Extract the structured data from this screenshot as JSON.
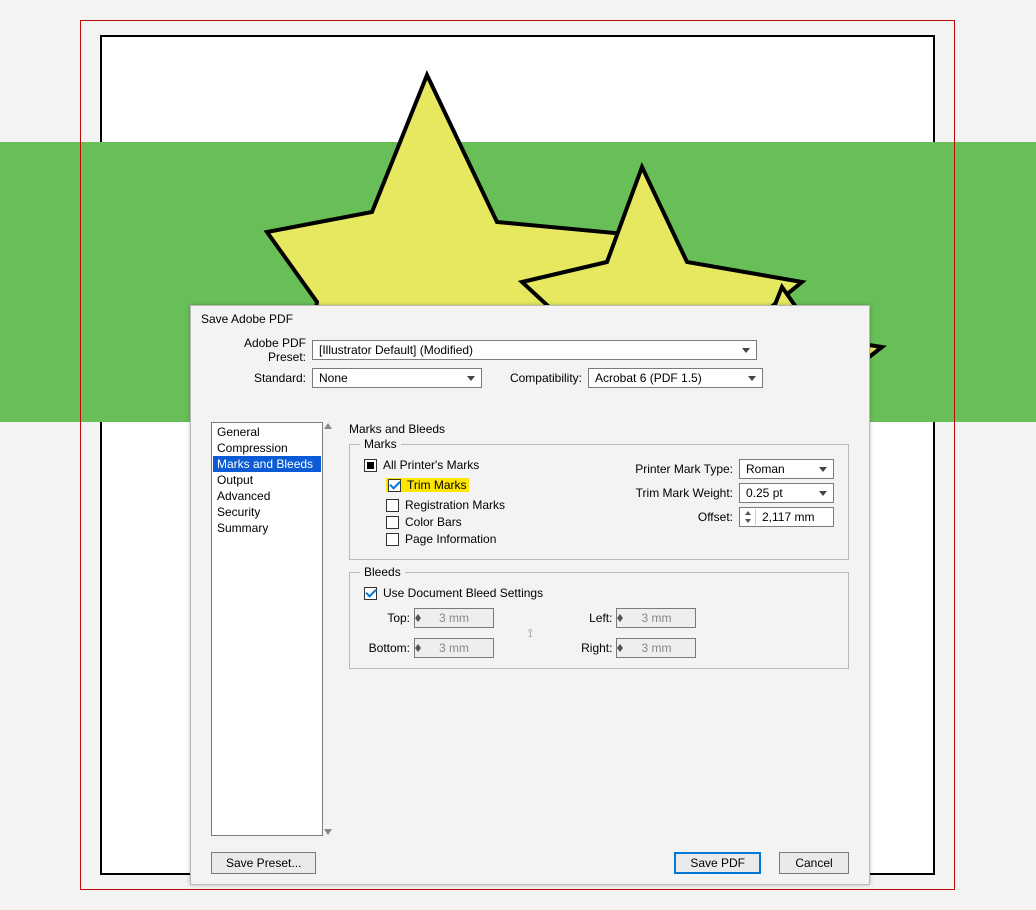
{
  "background": {
    "green_band_color": "#69bf57",
    "star_fill": "#e6e85f"
  },
  "dialog": {
    "title": "Save Adobe PDF",
    "preset_label": "Adobe PDF Preset:",
    "preset_value": "[Illustrator Default] (Modified)",
    "standard_label": "Standard:",
    "standard_value": "None",
    "compat_label": "Compatibility:",
    "compat_value": "Acrobat 6 (PDF 1.5)"
  },
  "sidebar": {
    "items": [
      "General",
      "Compression",
      "Marks and Bleeds",
      "Output",
      "Advanced",
      "Security",
      "Summary"
    ],
    "selected_index": 2
  },
  "panel": {
    "title": "Marks and Bleeds",
    "marks_legend": "Marks",
    "bleeds_legend": "Bleeds",
    "checks": {
      "all_printers_marks": "All Printer's Marks",
      "trim_marks": "Trim Marks",
      "registration_marks": "Registration Marks",
      "color_bars": "Color Bars",
      "page_information": "Page Information"
    },
    "right": {
      "printer_mark_type_label": "Printer Mark Type:",
      "printer_mark_type_value": "Roman",
      "trim_mark_weight_label": "Trim Mark Weight:",
      "trim_mark_weight_value": "0.25 pt",
      "offset_label": "Offset:",
      "offset_value": "2,117 mm"
    },
    "bleeds": {
      "use_document": "Use Document Bleed Settings",
      "top_label": "Top:",
      "bottom_label": "Bottom:",
      "left_label": "Left:",
      "right_label": "Right:",
      "value": "3 mm"
    }
  },
  "footer": {
    "save_preset": "Save Preset...",
    "save_pdf": "Save PDF",
    "cancel": "Cancel"
  }
}
